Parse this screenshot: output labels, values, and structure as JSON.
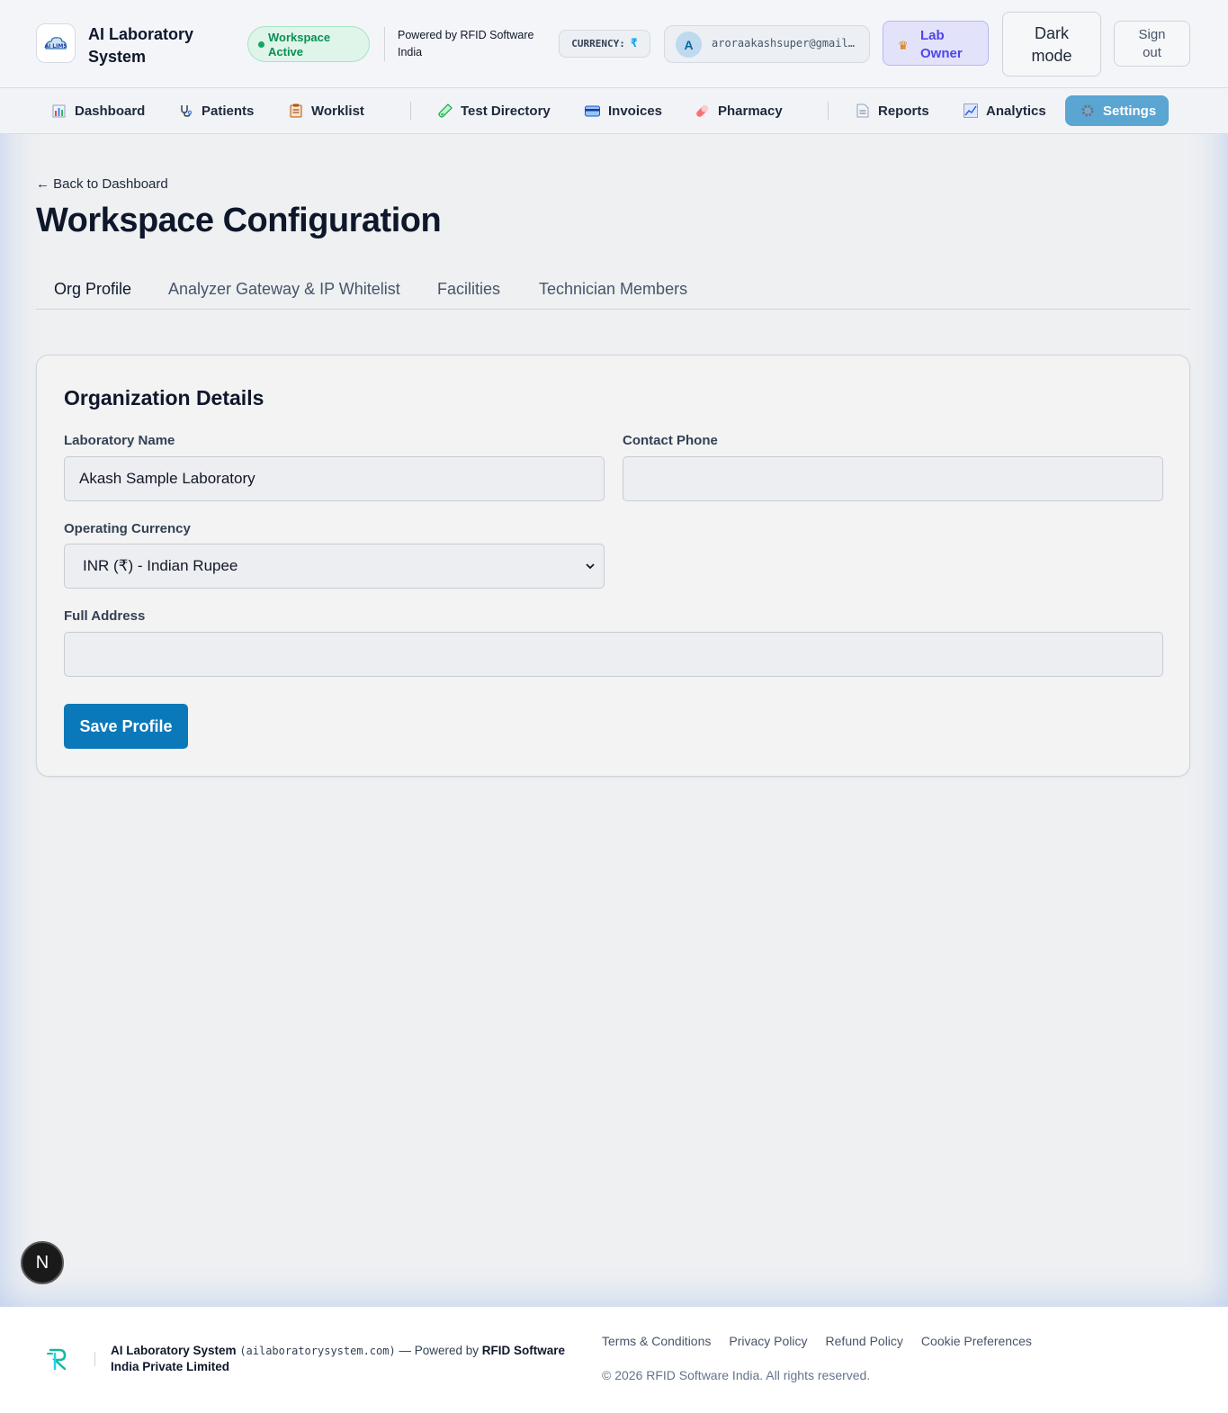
{
  "header": {
    "brand": "AI Laboratory System",
    "workspace_status": "Workspace Active",
    "powered_by": "Powered by RFID Software India",
    "currency_label": "CURRENCY:",
    "currency_symbol": "₹",
    "user_initial": "A",
    "user_email": "aroraakashsuper@gmail.com",
    "role": "Lab Owner",
    "dark_mode_label": "Dark mode",
    "sign_out_label": "Sign out"
  },
  "nav": {
    "items": [
      {
        "label": "Dashboard",
        "icon": "bar-chart-icon"
      },
      {
        "label": "Patients",
        "icon": "stethoscope-icon"
      },
      {
        "label": "Worklist",
        "icon": "clipboard-icon"
      },
      {
        "label": "Test Directory",
        "icon": "test-tube-icon"
      },
      {
        "label": "Invoices",
        "icon": "credit-card-icon"
      },
      {
        "label": "Pharmacy",
        "icon": "pill-icon"
      },
      {
        "label": "Reports",
        "icon": "document-icon"
      },
      {
        "label": "Analytics",
        "icon": "line-chart-icon"
      },
      {
        "label": "Settings",
        "icon": "gear-icon"
      }
    ],
    "active": "Settings"
  },
  "page": {
    "back_link": "← Back to Dashboard",
    "title": "Workspace Configuration",
    "tabs": [
      "Org Profile",
      "Analyzer Gateway & IP Whitelist",
      "Facilities",
      "Technician Members"
    ],
    "active_tab": "Org Profile"
  },
  "form": {
    "section_title": "Organization Details",
    "lab_name_label": "Laboratory Name",
    "lab_name_value": "Akash Sample Laboratory",
    "contact_phone_label": "Contact Phone",
    "contact_phone_value": "",
    "currency_label": "Operating Currency",
    "currency_value": "INR (₹) - Indian Rupee",
    "address_label": "Full Address",
    "address_value": "",
    "save_label": "Save Profile"
  },
  "floating": {
    "initial": "N"
  },
  "footer": {
    "app_name": "AI Laboratory System",
    "domain": "(ailaboratorysystem.com)",
    "powered_prefix": "— Powered by",
    "company": "RFID Software India Private Limited",
    "links": [
      "Terms & Conditions",
      "Privacy Policy",
      "Refund Policy",
      "Cookie Preferences"
    ],
    "copyright": "© 2026 RFID Software India. All rights reserved."
  },
  "colors": {
    "accent": "#0b79b9",
    "nav_active": "#5aa5d1",
    "status_green": "#10a866",
    "role_purple": "#4f46e5"
  }
}
